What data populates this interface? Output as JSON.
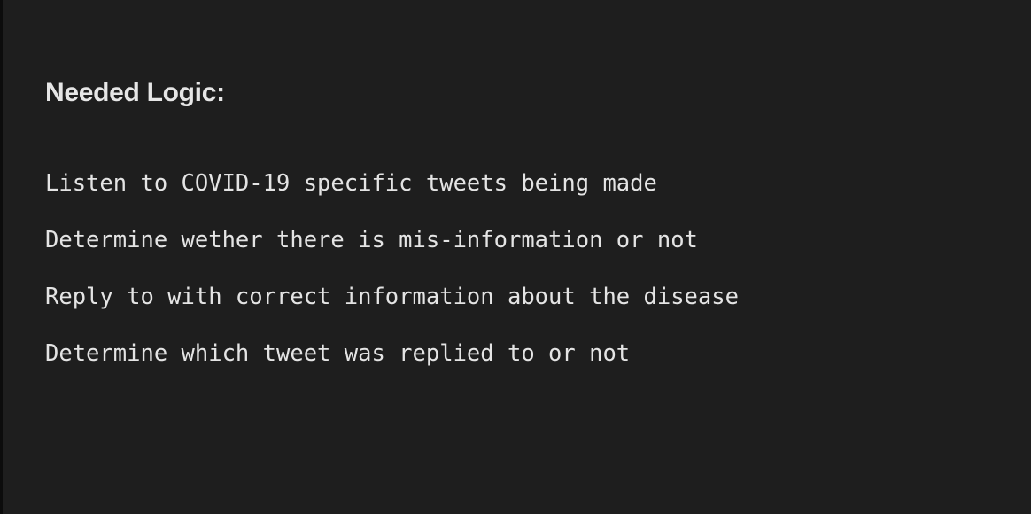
{
  "note": {
    "heading": "Needed Logic:",
    "lines": [
      "Listen to COVID-19 specific tweets being made",
      "Determine wether there is mis-information or not",
      "Reply to with correct information about the disease",
      "Determine which tweet was replied to or not"
    ]
  },
  "colors": {
    "background": "#1e1e1e",
    "text": "#e4e4e4",
    "left_border": "#0c0c0c"
  }
}
